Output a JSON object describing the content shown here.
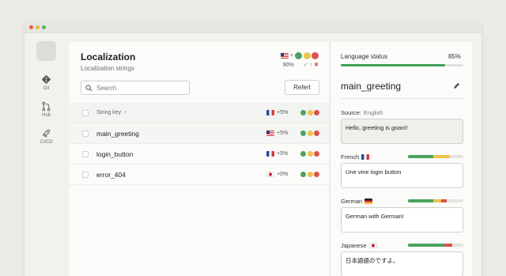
{
  "rail": {
    "items": [
      {
        "label": "Git",
        "icon": "git-icon"
      },
      {
        "label": "Hub",
        "icon": "hub-icon"
      },
      {
        "label": "CI/CD",
        "icon": "rocket-icon"
      }
    ]
  },
  "main": {
    "title": "Localization",
    "subtitle": "Localization strings",
    "header_progress": "90%",
    "header_flag": "us-flag-icon",
    "search_placeholder": "Search",
    "refresh_label": "Refert",
    "table": {
      "column_header": "String key",
      "header_delta": "+5%",
      "rows": [
        {
          "key": "main_greeting",
          "delta": "+5%",
          "flag": "us"
        },
        {
          "key": "login_button",
          "delta": "+5%",
          "flag": "fr"
        },
        {
          "key": "error_404",
          "delta": "+0%",
          "flag": "jp"
        }
      ]
    }
  },
  "panel": {
    "status_label": "Language status",
    "status_value": "85%",
    "status_fraction": 0.85,
    "key_title": "main_greeting",
    "source_label": "Source:",
    "source_lang": "English",
    "source_text": "Hello, greeting is goan!!",
    "translations": [
      {
        "lang": "French",
        "flag": "fr",
        "text": "Une vine login button",
        "progress": {
          "green": 0.45,
          "yellow": 0.3,
          "red": 0
        }
      },
      {
        "lang": "German",
        "flag": "de",
        "text": "German with German!",
        "progress": {
          "green": 0.45,
          "yellow": 0.15,
          "red": 0.1
        }
      },
      {
        "lang": "Japanese",
        "flag": "jp",
        "text": "日本語語のですよ。",
        "progress": {
          "green": 0.65,
          "yellow": 0,
          "red": 0.15
        }
      }
    ]
  },
  "colors": {
    "green": "#4ba35e",
    "yellow": "#edc34a",
    "red": "#d9534f"
  }
}
